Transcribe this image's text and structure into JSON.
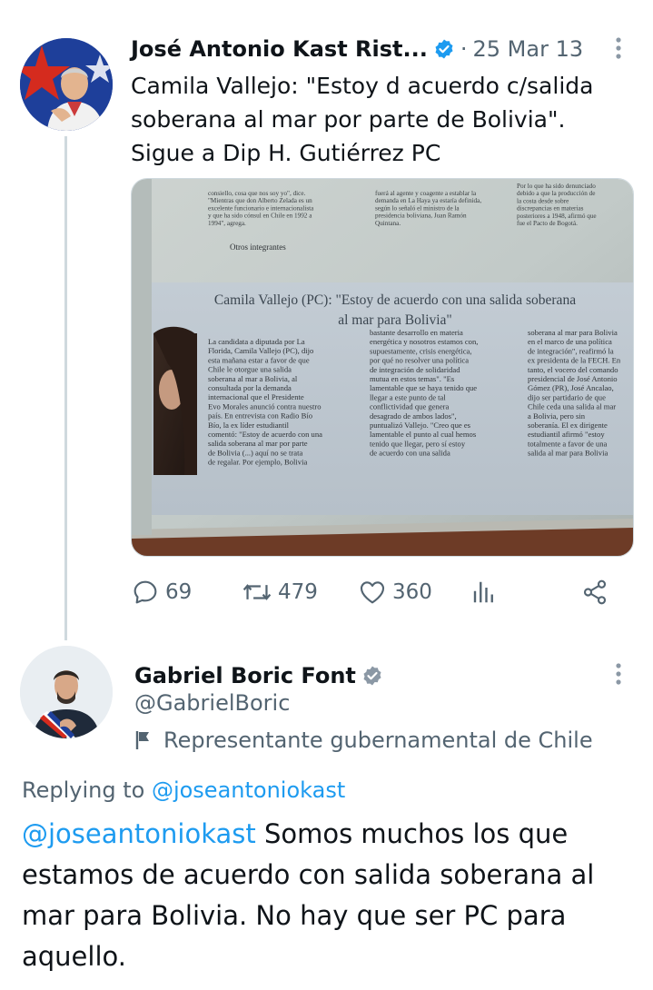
{
  "original_tweet": {
    "author_name": "José Antonio Kast Rist...",
    "separator": "·",
    "date": "25 Mar 13",
    "text": "Camila Vallejo: \"Estoy d acuerdo c/salida soberana al mar por parte de Bolivia\". Sigue a Dip H. Gutiérrez PC",
    "media": {
      "top_columns": [
        "consiello, cosa que nos soy yo\", dice. \"Mientras que don Alberto Zelada es un excelente funcionario e internacionalista y que ha sido cónsul en Chile en 1992 a 1994\", agrega.",
        "fuerá al agente y coagente a establar la demanda en La Haya ya estaría definida, según lo señaló el ministro de la presidencia boliviana, Juan Ramón Quintana.",
        "Por lo que ha sido denunciado debido a que la producción de la costa desde sobre discrepancias en materias posteriores a 1948, afirmó que fue el Pacto de Bogotá."
      ],
      "subhead": "Otros integrantes",
      "headline": "Camila Vallejo (PC): \"Estoy de acuerdo con una salida soberana al mar para Bolivia\"",
      "body_col1": "La candidata a diputada por La Florida, Camila Vallejo (PC), dijo esta mañana estar a favor de que Chile le otorgue una salida soberana al mar a Bolivia, al consultada por la demanda internacional que el Presidente Evo Morales anunció contra nuestro país. En entrevista con Radio Bío Bío, la ex líder estudiantil comentó: \"Estoy de acuerdo con una salida soberana al mar por parte de Bolivia (...) aquí no se trata de regalar. Por ejemplo, Bolivia es un país que tiene",
      "body_col2": "bastante desarrollo en materia energética y nosotros estamos con, supuestamente, crisis energética, por qué no resolver una política de integración de solidaridad mutua en estos temas\". \"Es lamentable que se haya tenido que llegar a este punto de tal conflictividad que genera desagrado de ambos lados\", puntualizó Vallejo. \"Creo que es lamentable el punto al cual hemos tenido que llegar, pero sí estoy de acuerdo con una salida",
      "body_col3": "soberana al mar para Bolivia en el marco de una política de integración\", reafirmó la ex presidenta de la FECH. En tanto, el vocero del comando presidencial de José Antonio Gómez (PR), José Ancalao, dijo ser partidario de que Chile ceda una salida al mar a Bolivia, pero sin soberanía. El ex dirigente estudiantil afirmó \"estoy totalmente a favor de una salida al mar para Bolivia sin soberanía, pero coherente con el desarrollo de nuestro vecino\"."
    },
    "actions": {
      "replies": "69",
      "retweets": "479",
      "likes": "360"
    }
  },
  "reply_tweet": {
    "author_name": "Gabriel Boric Font",
    "handle": "@GabrielBoric",
    "affiliation": "Representante gubernamental de Chile",
    "replying_prefix": "Replying to",
    "replying_to": "@joseantoniokast",
    "mention": "@joseantoniokast",
    "text": " Somos muchos los que estamos de acuerdo con salida soberana al mar para Bolivia. No hay que ser PC para aquello."
  },
  "colors": {
    "accent_blue": "#1d9bf0",
    "muted_gray": "#536471",
    "text": "#0f1419",
    "thread_line": "#cfd9de",
    "chile_red": "#d52b1e",
    "chile_blue": "#1e3f9a"
  },
  "icons": {
    "verified": "verified-badge-icon",
    "more": "more-dots-icon",
    "reply": "reply-icon",
    "retweet": "retweet-icon",
    "like": "heart-icon",
    "views": "analytics-icon",
    "share": "share-icon",
    "affiliation": "flag-icon"
  }
}
